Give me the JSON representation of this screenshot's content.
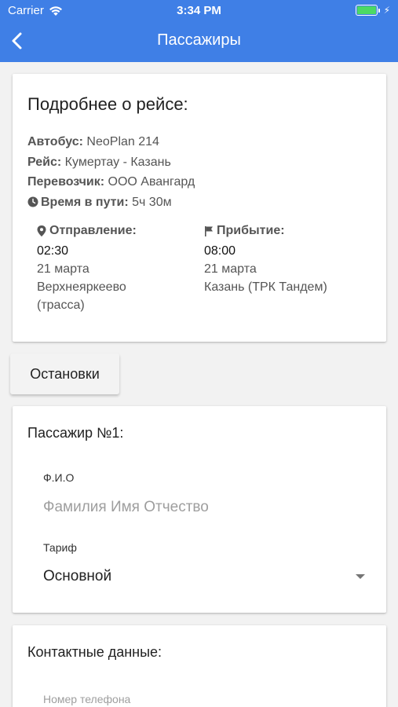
{
  "status": {
    "carrier": "Carrier",
    "time": "3:34 PM",
    "battery_level": 1.0,
    "battery_color": "#4cd964"
  },
  "nav": {
    "title": "Пассажиры",
    "bar_color": "#3f7fe6"
  },
  "trip": {
    "title": "Подробнее о рейсе:",
    "bus_label": "Автобус:",
    "bus_value": " NeoPlan 214",
    "route_label": "Рейс:",
    "route_value": " Кумертау - Казань",
    "carrier_label": "Перевозчик:",
    "carrier_value": " ООО Авангард",
    "duration_label": "Время в пути:",
    "duration_value": " 5ч 30м",
    "departure": {
      "label": "Отправление:",
      "time": "02:30",
      "date": "21 марта",
      "place_line1": "Верхнеяркеево",
      "place_line2": "(трасса)"
    },
    "arrival": {
      "label": "Прибытие:",
      "time": "08:00",
      "date": "21 марта",
      "place": "Казань (ТРК Тандем)"
    }
  },
  "stops_button": "Остановки",
  "passenger": {
    "title": "Пассажир №1:",
    "fio_label": "Ф.И.О",
    "fio_placeholder": "Фамилия Имя Отчество",
    "fio_value": "",
    "tariff_label": "Тариф",
    "tariff_value": "Основной"
  },
  "contacts": {
    "title": "Контактные данные:",
    "phone_placeholder": "Номер телефона",
    "phone_value": ""
  },
  "icons": {
    "back": "chevron-left-icon",
    "clock": "clock-icon",
    "pin": "map-pin-icon",
    "flag": "flag-icon",
    "wifi": "wifi-icon",
    "battery": "battery-icon",
    "dropdown": "chevron-down-icon"
  }
}
